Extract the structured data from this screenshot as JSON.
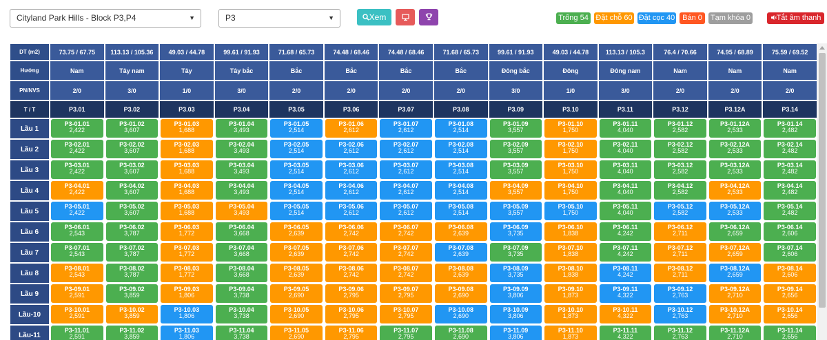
{
  "toolbar": {
    "project": "Cityland Park Hills - Block P3,P4",
    "block": "P3",
    "view_label": "Xem",
    "icons": {
      "view": "search-icon",
      "monitor": "monitor-icon",
      "trophy": "trophy-icon"
    }
  },
  "badges": [
    {
      "label": "Trống 54",
      "color": "#4caf50"
    },
    {
      "label": "Đặt chỗ 60",
      "color": "#ff9800"
    },
    {
      "label": "Đặt cọc 40",
      "color": "#2196f3"
    },
    {
      "label": "Bán 0",
      "color": "#ff5722"
    },
    {
      "label": "Tạm khóa 0",
      "color": "#9e9e9e"
    }
  ],
  "sound_button": {
    "label": "Tắt âm thanh",
    "color": "#d9262c",
    "icon": "speaker-icon"
  },
  "status_colors": {
    "g": "#4caf50",
    "o": "#ff9800",
    "b": "#2196f3"
  },
  "header_labels": {
    "area": "DT (m2)",
    "direction": "Hướng",
    "rooms": "PN/NVS",
    "tt": "T / T"
  },
  "columns": [
    {
      "area": "73.75 / 67.75",
      "dir": "Nam",
      "rooms": "2/0",
      "code": "P3.01"
    },
    {
      "area": "113.13 / 105.36",
      "dir": "Tây nam",
      "rooms": "3/0",
      "code": "P3.02"
    },
    {
      "area": "49.03 / 44.78",
      "dir": "Tây",
      "rooms": "1/0",
      "code": "P3.03"
    },
    {
      "area": "99.61 / 91.93",
      "dir": "Tây bắc",
      "rooms": "3/0",
      "code": "P3.04"
    },
    {
      "area": "71.68 / 65.73",
      "dir": "Bắc",
      "rooms": "2/0",
      "code": "P3.05"
    },
    {
      "area": "74.48 / 68.46",
      "dir": "Bắc",
      "rooms": "2/0",
      "code": "P3.06"
    },
    {
      "area": "74.48 / 68.46",
      "dir": "Bắc",
      "rooms": "2/0",
      "code": "P3.07"
    },
    {
      "area": "71.68 / 65.73",
      "dir": "Bắc",
      "rooms": "2/0",
      "code": "P3.08"
    },
    {
      "area": "99.61 / 91.93",
      "dir": "Đông bắc",
      "rooms": "3/0",
      "code": "P3.09"
    },
    {
      "area": "49.03 / 44.78",
      "dir": "Đông",
      "rooms": "1/0",
      "code": "P3.10"
    },
    {
      "area": "113.13 / 105.3",
      "dir": "Đông nam",
      "rooms": "3/0",
      "code": "P3.11"
    },
    {
      "area": "76.4 / 70.66",
      "dir": "Nam",
      "rooms": "2/0",
      "code": "P3.12"
    },
    {
      "area": "74.95 / 68.89",
      "dir": "Nam",
      "rooms": "2/0",
      "code": "P3.12A"
    },
    {
      "area": "75.59 / 69.52",
      "dir": "Nam",
      "rooms": "2/0",
      "code": "P3.14"
    }
  ],
  "floors": [
    {
      "label": "Lầu 1",
      "units": [
        {
          "code": "P3-01.01",
          "price": "2,422",
          "s": "g"
        },
        {
          "code": "P3-01.02",
          "price": "3,607",
          "s": "g"
        },
        {
          "code": "P3-01.03",
          "price": "1,688",
          "s": "o"
        },
        {
          "code": "P3-01.04",
          "price": "3,493",
          "s": "g"
        },
        {
          "code": "P3-01.05",
          "price": "2,514",
          "s": "b"
        },
        {
          "code": "P3-01.06",
          "price": "2,612",
          "s": "o"
        },
        {
          "code": "P3-01.07",
          "price": "2,612",
          "s": "b"
        },
        {
          "code": "P3-01.08",
          "price": "2,514",
          "s": "b"
        },
        {
          "code": "P3-01.09",
          "price": "3,557",
          "s": "g"
        },
        {
          "code": "P3-01.10",
          "price": "1,750",
          "s": "o"
        },
        {
          "code": "P3-01.11",
          "price": "4,040",
          "s": "g"
        },
        {
          "code": "P3-01.12",
          "price": "2,582",
          "s": "g"
        },
        {
          "code": "P3-01.12A",
          "price": "2,533",
          "s": "g"
        },
        {
          "code": "P3-01.14",
          "price": "2,482",
          "s": "g"
        }
      ]
    },
    {
      "label": "Lầu 2",
      "units": [
        {
          "code": "P3-02.01",
          "price": "2,422",
          "s": "g"
        },
        {
          "code": "P3-02.02",
          "price": "3,607",
          "s": "g"
        },
        {
          "code": "P3-02.03",
          "price": "1,688",
          "s": "o"
        },
        {
          "code": "P3-02.04",
          "price": "3,493",
          "s": "g"
        },
        {
          "code": "P3-02.05",
          "price": "2,514",
          "s": "b"
        },
        {
          "code": "P3-02.06",
          "price": "2,612",
          "s": "b"
        },
        {
          "code": "P3-02.07",
          "price": "2,612",
          "s": "b"
        },
        {
          "code": "P3-02.08",
          "price": "2,514",
          "s": "b"
        },
        {
          "code": "P3-02.09",
          "price": "3,557",
          "s": "g"
        },
        {
          "code": "P3-02.10",
          "price": "1,750",
          "s": "o"
        },
        {
          "code": "P3-02.11",
          "price": "4,040",
          "s": "g"
        },
        {
          "code": "P3-02.12",
          "price": "2,582",
          "s": "g"
        },
        {
          "code": "P3-02.12A",
          "price": "2,533",
          "s": "g"
        },
        {
          "code": "P3-02.14",
          "price": "2,482",
          "s": "g"
        }
      ]
    },
    {
      "label": "Lầu 3",
      "units": [
        {
          "code": "P3-03.01",
          "price": "2,422",
          "s": "g"
        },
        {
          "code": "P3-03.02",
          "price": "3,607",
          "s": "g"
        },
        {
          "code": "P3-03.03",
          "price": "1,688",
          "s": "o"
        },
        {
          "code": "P3-03.04",
          "price": "3,493",
          "s": "g"
        },
        {
          "code": "P3-03.05",
          "price": "2,514",
          "s": "b"
        },
        {
          "code": "P3-03.06",
          "price": "2,612",
          "s": "b"
        },
        {
          "code": "P3-03.07",
          "price": "2,612",
          "s": "b"
        },
        {
          "code": "P3-03.08",
          "price": "2,514",
          "s": "b"
        },
        {
          "code": "P3-03.09",
          "price": "3,557",
          "s": "g"
        },
        {
          "code": "P3-03.10",
          "price": "1,750",
          "s": "o"
        },
        {
          "code": "P3-03.11",
          "price": "4,040",
          "s": "g"
        },
        {
          "code": "P3-03.12",
          "price": "2,582",
          "s": "g"
        },
        {
          "code": "P3-03.12A",
          "price": "2,533",
          "s": "g"
        },
        {
          "code": "P3-03.14",
          "price": "2,482",
          "s": "g"
        }
      ]
    },
    {
      "label": "Lầu 4",
      "units": [
        {
          "code": "P3-04.01",
          "price": "2,422",
          "s": "o"
        },
        {
          "code": "P3-04.02",
          "price": "3,607",
          "s": "g"
        },
        {
          "code": "P3-04.03",
          "price": "1,688",
          "s": "o"
        },
        {
          "code": "P3-04.04",
          "price": "3,493",
          "s": "g"
        },
        {
          "code": "P3-04.05",
          "price": "2,514",
          "s": "b"
        },
        {
          "code": "P3-04.06",
          "price": "2,612",
          "s": "b"
        },
        {
          "code": "P3-04.07",
          "price": "2,612",
          "s": "b"
        },
        {
          "code": "P3-04.08",
          "price": "2,514",
          "s": "b"
        },
        {
          "code": "P3-04.09",
          "price": "3,557",
          "s": "o"
        },
        {
          "code": "P3-04.10",
          "price": "1,750",
          "s": "o"
        },
        {
          "code": "P3-04.11",
          "price": "4,040",
          "s": "g"
        },
        {
          "code": "P3-04.12",
          "price": "2,582",
          "s": "g"
        },
        {
          "code": "P3-04.12A",
          "price": "2,533",
          "s": "o"
        },
        {
          "code": "P3-04.14",
          "price": "2,482",
          "s": "g"
        }
      ]
    },
    {
      "label": "Lầu 5",
      "units": [
        {
          "code": "P3-05.01",
          "price": "2,422",
          "s": "b"
        },
        {
          "code": "P3-05.02",
          "price": "3,607",
          "s": "g"
        },
        {
          "code": "P3-05.03",
          "price": "1,688",
          "s": "o"
        },
        {
          "code": "P3-05.04",
          "price": "3,493",
          "s": "o"
        },
        {
          "code": "P3-05.05",
          "price": "2,514",
          "s": "b"
        },
        {
          "code": "P3-05.06",
          "price": "2,612",
          "s": "b"
        },
        {
          "code": "P3-05.07",
          "price": "2,612",
          "s": "b"
        },
        {
          "code": "P3-05.08",
          "price": "2,514",
          "s": "b"
        },
        {
          "code": "P3-05.09",
          "price": "3,557",
          "s": "b"
        },
        {
          "code": "P3-05.10",
          "price": "1,750",
          "s": "b"
        },
        {
          "code": "P3-05.11",
          "price": "4,040",
          "s": "g"
        },
        {
          "code": "P3-05.12",
          "price": "2,582",
          "s": "b"
        },
        {
          "code": "P3-05.12A",
          "price": "2,533",
          "s": "b"
        },
        {
          "code": "P3-05.14",
          "price": "2,482",
          "s": "g"
        }
      ]
    },
    {
      "label": "Lầu 6",
      "units": [
        {
          "code": "P3-06.01",
          "price": "2,543",
          "s": "g"
        },
        {
          "code": "P3-06.02",
          "price": "3,787",
          "s": "g"
        },
        {
          "code": "P3-06.03",
          "price": "1,772",
          "s": "o"
        },
        {
          "code": "P3-06.04",
          "price": "3,668",
          "s": "g"
        },
        {
          "code": "P3-06.05",
          "price": "2,639",
          "s": "o"
        },
        {
          "code": "P3-06.06",
          "price": "2,742",
          "s": "o"
        },
        {
          "code": "P3-06.07",
          "price": "2,742",
          "s": "o"
        },
        {
          "code": "P3-06.08",
          "price": "2,639",
          "s": "o"
        },
        {
          "code": "P3-06.09",
          "price": "3,735",
          "s": "b"
        },
        {
          "code": "P3-06.10",
          "price": "1,838",
          "s": "o"
        },
        {
          "code": "P3-06.11",
          "price": "4,242",
          "s": "g"
        },
        {
          "code": "P3-06.12",
          "price": "2,711",
          "s": "o"
        },
        {
          "code": "P3-06.12A",
          "price": "2,659",
          "s": "g"
        },
        {
          "code": "P3-06.14",
          "price": "2,606",
          "s": "g"
        }
      ]
    },
    {
      "label": "Lầu 7",
      "units": [
        {
          "code": "P3-07.01",
          "price": "2,543",
          "s": "g"
        },
        {
          "code": "P3-07.02",
          "price": "3,787",
          "s": "g"
        },
        {
          "code": "P3-07.03",
          "price": "1,772",
          "s": "o"
        },
        {
          "code": "P3-07.04",
          "price": "3,668",
          "s": "g"
        },
        {
          "code": "P3-07.05",
          "price": "2,639",
          "s": "o"
        },
        {
          "code": "P3-07.06",
          "price": "2,742",
          "s": "o"
        },
        {
          "code": "P3-07.07",
          "price": "2,742",
          "s": "o"
        },
        {
          "code": "P3-07.08",
          "price": "2,639",
          "s": "b"
        },
        {
          "code": "P3-07.09",
          "price": "3,735",
          "s": "g"
        },
        {
          "code": "P3-07.10",
          "price": "1,838",
          "s": "o"
        },
        {
          "code": "P3-07.11",
          "price": "4,242",
          "s": "g"
        },
        {
          "code": "P3-07.12",
          "price": "2,711",
          "s": "o"
        },
        {
          "code": "P3-07.12A",
          "price": "2,659",
          "s": "o"
        },
        {
          "code": "P3-07.14",
          "price": "2,606",
          "s": "g"
        }
      ]
    },
    {
      "label": "Lầu 8",
      "units": [
        {
          "code": "P3-08.01",
          "price": "2,543",
          "s": "o"
        },
        {
          "code": "P3-08.02",
          "price": "3,787",
          "s": "g"
        },
        {
          "code": "P3-08.03",
          "price": "1,772",
          "s": "o"
        },
        {
          "code": "P3-08.04",
          "price": "3,668",
          "s": "g"
        },
        {
          "code": "P3-08.05",
          "price": "2,639",
          "s": "o"
        },
        {
          "code": "P3-08.06",
          "price": "2,742",
          "s": "o"
        },
        {
          "code": "P3-08.07",
          "price": "2,742",
          "s": "o"
        },
        {
          "code": "P3-08.08",
          "price": "2,639",
          "s": "o"
        },
        {
          "code": "P3-08.09",
          "price": "3,735",
          "s": "b"
        },
        {
          "code": "P3-08.10",
          "price": "1,838",
          "s": "o"
        },
        {
          "code": "P3-08.11",
          "price": "4,242",
          "s": "b"
        },
        {
          "code": "P3-08.12",
          "price": "2,711",
          "s": "o"
        },
        {
          "code": "P3-08.12A",
          "price": "2,659",
          "s": "b"
        },
        {
          "code": "P3-08.14",
          "price": "2,606",
          "s": "o"
        }
      ]
    },
    {
      "label": "Lầu 9",
      "units": [
        {
          "code": "P3-09.01",
          "price": "2,591",
          "s": "o"
        },
        {
          "code": "P3-09.02",
          "price": "3,859",
          "s": "g"
        },
        {
          "code": "P3-09.03",
          "price": "1,806",
          "s": "o"
        },
        {
          "code": "P3-09.04",
          "price": "3,738",
          "s": "g"
        },
        {
          "code": "P3-09.05",
          "price": "2,690",
          "s": "o"
        },
        {
          "code": "P3-09.06",
          "price": "2,795",
          "s": "o"
        },
        {
          "code": "P3-09.07",
          "price": "2,795",
          "s": "o"
        },
        {
          "code": "P3-09.08",
          "price": "2,690",
          "s": "o"
        },
        {
          "code": "P3-09.09",
          "price": "3,806",
          "s": "b"
        },
        {
          "code": "P3-09.10",
          "price": "1,873",
          "s": "o"
        },
        {
          "code": "P3-09.11",
          "price": "4,322",
          "s": "b"
        },
        {
          "code": "P3-09.12",
          "price": "2,763",
          "s": "b"
        },
        {
          "code": "P3-09.12A",
          "price": "2,710",
          "s": "o"
        },
        {
          "code": "P3-09.14",
          "price": "2,656",
          "s": "o"
        }
      ]
    },
    {
      "label": "Lầu-10",
      "units": [
        {
          "code": "P3-10.01",
          "price": "2,591",
          "s": "o"
        },
        {
          "code": "P3-10.02",
          "price": "3,859",
          "s": "o"
        },
        {
          "code": "P3-10.03",
          "price": "1,806",
          "s": "b"
        },
        {
          "code": "P3-10.04",
          "price": "3,738",
          "s": "g"
        },
        {
          "code": "P3-10.05",
          "price": "2,690",
          "s": "o"
        },
        {
          "code": "P3-10.06",
          "price": "2,795",
          "s": "o"
        },
        {
          "code": "P3-10.07",
          "price": "2,795",
          "s": "o"
        },
        {
          "code": "P3-10.08",
          "price": "2,690",
          "s": "b"
        },
        {
          "code": "P3-10.09",
          "price": "3,806",
          "s": "b"
        },
        {
          "code": "P3-10.10",
          "price": "1,873",
          "s": "o"
        },
        {
          "code": "P3-10.11",
          "price": "4,322",
          "s": "o"
        },
        {
          "code": "P3-10.12",
          "price": "2,763",
          "s": "b"
        },
        {
          "code": "P3-10.12A",
          "price": "2,710",
          "s": "o"
        },
        {
          "code": "P3-10.14",
          "price": "2,656",
          "s": "o"
        }
      ]
    },
    {
      "label": "Lầu-11",
      "units": [
        {
          "code": "P3-11.01",
          "price": "2,591",
          "s": "g"
        },
        {
          "code": "P3-11.02",
          "price": "3,859",
          "s": "g"
        },
        {
          "code": "P3-11.03",
          "price": "1,806",
          "s": "b"
        },
        {
          "code": "P3-11.04",
          "price": "3,738",
          "s": "g"
        },
        {
          "code": "P3-11.05",
          "price": "2,690",
          "s": "o"
        },
        {
          "code": "P3-11.06",
          "price": "2,795",
          "s": "o"
        },
        {
          "code": "P3-11.07",
          "price": "2,795",
          "s": "g"
        },
        {
          "code": "P3-11.08",
          "price": "2,690",
          "s": "g"
        },
        {
          "code": "P3-11.09",
          "price": "3,806",
          "s": "b"
        },
        {
          "code": "P3-11.10",
          "price": "1,873",
          "s": "o"
        },
        {
          "code": "P3-11.11",
          "price": "4,322",
          "s": "g"
        },
        {
          "code": "P3-11.12",
          "price": "2,763",
          "s": "g"
        },
        {
          "code": "P3-11.12A",
          "price": "2,710",
          "s": "g"
        },
        {
          "code": "P3-11.14",
          "price": "2,656",
          "s": "g"
        }
      ]
    }
  ]
}
